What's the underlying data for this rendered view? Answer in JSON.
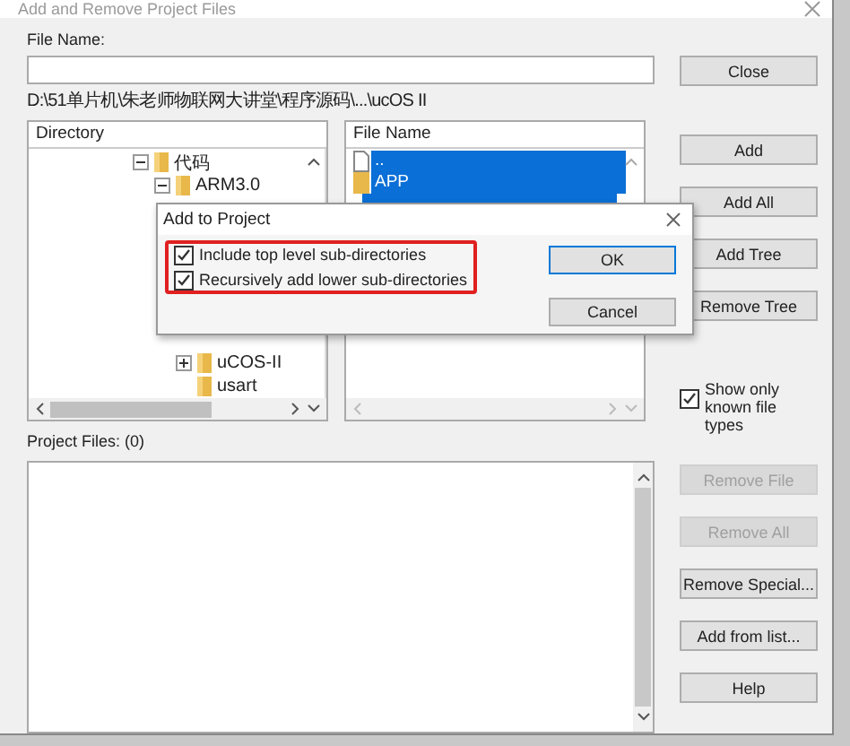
{
  "window": {
    "title": "Add and Remove Project Files"
  },
  "file_name": {
    "label": "File Name:"
  },
  "path": "D:\\51单片机\\朱老师物联网大讲堂\\程序源码\\...\\ucOS II",
  "directory": {
    "header": "Directory",
    "tree": [
      {
        "label": "代码",
        "expanded": true,
        "children": [
          {
            "label": "ARM3.0",
            "expanded": true,
            "children": [
              {
                "label": "uCOS-II",
                "expanded": false
              },
              {
                "label": "usart"
              }
            ]
          }
        ]
      }
    ]
  },
  "files": {
    "header": "File Name",
    "items": [
      {
        "label": "..",
        "kind": "file",
        "selected": true
      },
      {
        "label": "APP",
        "kind": "folder",
        "selected": true
      }
    ]
  },
  "buttons_top": [
    {
      "label": "Close",
      "disabled": false
    }
  ],
  "buttons_mid": [
    {
      "label": "Add",
      "disabled": false
    },
    {
      "label": "Add All",
      "disabled": false
    },
    {
      "label": "Add Tree",
      "disabled": false
    },
    {
      "label": "Remove Tree",
      "disabled": false
    }
  ],
  "show_known": {
    "label": "Show only known file types",
    "checked": true
  },
  "project_files": {
    "label": "Project Files: (0)"
  },
  "buttons_bottom": [
    {
      "label": "Remove File",
      "disabled": true
    },
    {
      "label": "Remove All",
      "disabled": true
    },
    {
      "label": "Remove Special...",
      "disabled": false
    },
    {
      "label": "Add from list...",
      "disabled": false
    },
    {
      "label": "Help",
      "disabled": false
    }
  ],
  "modal": {
    "title": "Add to Project",
    "options": [
      {
        "label": "Include top level sub-directories",
        "checked": true
      },
      {
        "label": "Recursively add lower sub-directories",
        "checked": true
      }
    ],
    "buttons": [
      {
        "label": "OK",
        "default": true
      },
      {
        "label": "Cancel",
        "default": false
      }
    ]
  }
}
